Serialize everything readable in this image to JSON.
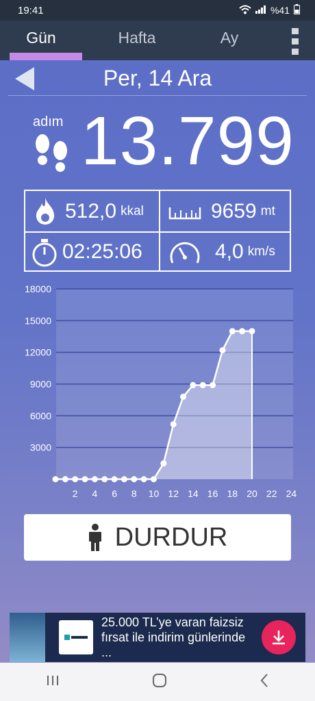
{
  "status_bar": {
    "time": "19:41",
    "battery": "%41"
  },
  "tabs": [
    {
      "label": "Gün",
      "active": true
    },
    {
      "label": "Hafta",
      "active": false
    },
    {
      "label": "Ay",
      "active": false
    }
  ],
  "header": {
    "date": "Per, 14 Ara"
  },
  "steps": {
    "label": "adım",
    "count": "13.799"
  },
  "stats": {
    "calories": {
      "value": "512,0",
      "unit": "kkal"
    },
    "distance": {
      "value": "9659",
      "unit": "mt"
    },
    "duration": {
      "value": "02:25:06"
    },
    "speed": {
      "value": "4,0",
      "unit": "km/s"
    }
  },
  "chart_data": {
    "type": "area",
    "x": [
      0,
      1,
      2,
      3,
      4,
      5,
      6,
      7,
      8,
      9,
      10,
      11,
      12,
      13,
      14,
      15,
      16,
      17,
      18,
      19,
      20
    ],
    "values": [
      0,
      0,
      0,
      0,
      0,
      0,
      0,
      0,
      0,
      0,
      0,
      1500,
      5200,
      7800,
      8900,
      8900,
      8900,
      12200,
      14000,
      14000,
      14000
    ],
    "xticks": [
      "2",
      "4",
      "6",
      "8",
      "10",
      "12",
      "14",
      "16",
      "18",
      "20",
      "22",
      "24"
    ],
    "yticks": [
      "3000",
      "6000",
      "9000",
      "12000",
      "15000",
      "18000"
    ],
    "xlim": [
      -1,
      24
    ],
    "ylim": [
      0,
      18000
    ],
    "grid": true
  },
  "stop_button": {
    "label": "DURDUR"
  },
  "ad": {
    "text": "25.000 TL’ye varan faizsiz fırsat ile indirim günlerinde ..."
  },
  "colors": {
    "accent": "#c58ae6",
    "tabbar": "#2f3b4f",
    "cta": "#e8245c"
  }
}
